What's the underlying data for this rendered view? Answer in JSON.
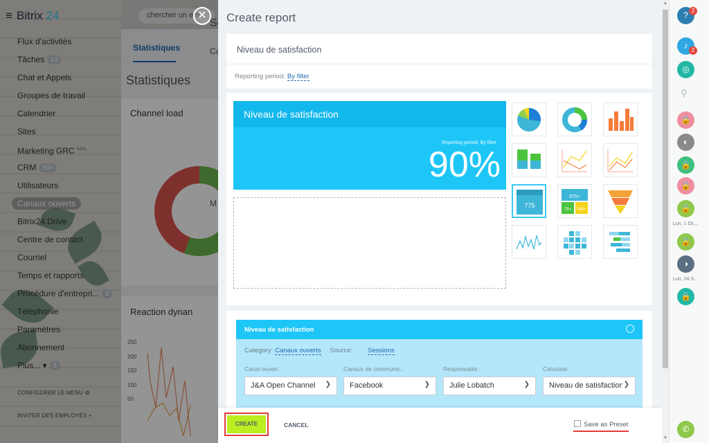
{
  "background": {
    "logo": {
      "text": "Bitrix",
      "number": "24"
    },
    "search_placeholder": "chercher un em",
    "menu": [
      {
        "label": "Flux d'activités"
      },
      {
        "label": "Tâches",
        "badge": "13"
      },
      {
        "label": "Chat et Appels"
      },
      {
        "label": "Groupes de travail"
      },
      {
        "label": "Calendrier"
      },
      {
        "label": "Sites"
      },
      {
        "label": "Marketing GRC",
        "sup": "beta"
      },
      {
        "label": "CRM",
        "badge": "50+"
      },
      {
        "label": "Utilisateurs"
      },
      {
        "label": "Canaux ouverts",
        "active": true
      },
      {
        "label": "Bitrix24.Drive"
      },
      {
        "label": "Centre de contact"
      },
      {
        "label": "Courriel"
      },
      {
        "label": "Temps et rapports"
      },
      {
        "label": "Procédure d'entrepri...",
        "badge": "2"
      },
      {
        "label": "Téléphonie"
      },
      {
        "label": "Paramètres"
      },
      {
        "label": "Abonnement"
      },
      {
        "label": "Plus... ▾",
        "badge": "3"
      }
    ],
    "configure_menu": "CONFIGURER LE MENU",
    "invite": "INVITER DES EMPLOYÉS",
    "tab": "Statistiques",
    "page_title": "Statistiques",
    "card1_title": "Channel load",
    "card2_title": "Reaction dynan",
    "axis_ticks": [
      "250",
      "200",
      "150",
      "100",
      "50"
    ],
    "partial_labels": {
      "header": "Se",
      "ca": "Ca",
      "m": "M"
    }
  },
  "panel": {
    "title": "Create report",
    "report_name": "Niveau de satisfaction",
    "period_label": "Reporting period:",
    "period_value": "By filter",
    "preview": {
      "title": "Niveau de satisfaction",
      "period": "Reporting period: By filter",
      "value": "90%",
      "color": "#1ec6f8"
    },
    "widget": {
      "title": "Niveau de satisfaction",
      "category_label": "Category:",
      "category_value": "Canaux ouverts",
      "source_label": "Source:",
      "source_value": "Sessions",
      "fields": [
        {
          "label": "Canal ouvert :",
          "value": "J&A Open Channel"
        },
        {
          "label": "Canaux de communic...",
          "value": "Facebook"
        },
        {
          "label": "Responsable :",
          "value": "Julie Lobatch"
        },
        {
          "label": "Calculate:",
          "value": "Niveau de satisfaction"
        }
      ]
    },
    "thumb_samples": {
      "number_widget": "775",
      "grid_a": "975+",
      "grid_b": "75+",
      "grid_c": "995+"
    },
    "footer": {
      "create": "CREATE",
      "cancel": "CANCEL",
      "save_preset": "Save as Preset"
    }
  },
  "rightbar": {
    "help_badge": "2",
    "notif_badge": "2",
    "label_1": "Lun, 1 Oc...",
    "label_2": "Lun, 24 S..."
  },
  "colors": {
    "accent": "#1ec6f8",
    "create": "#bbed21",
    "highlight": "#e23b3b",
    "green": "#3fbf7f",
    "pink": "#ee8e9f"
  }
}
